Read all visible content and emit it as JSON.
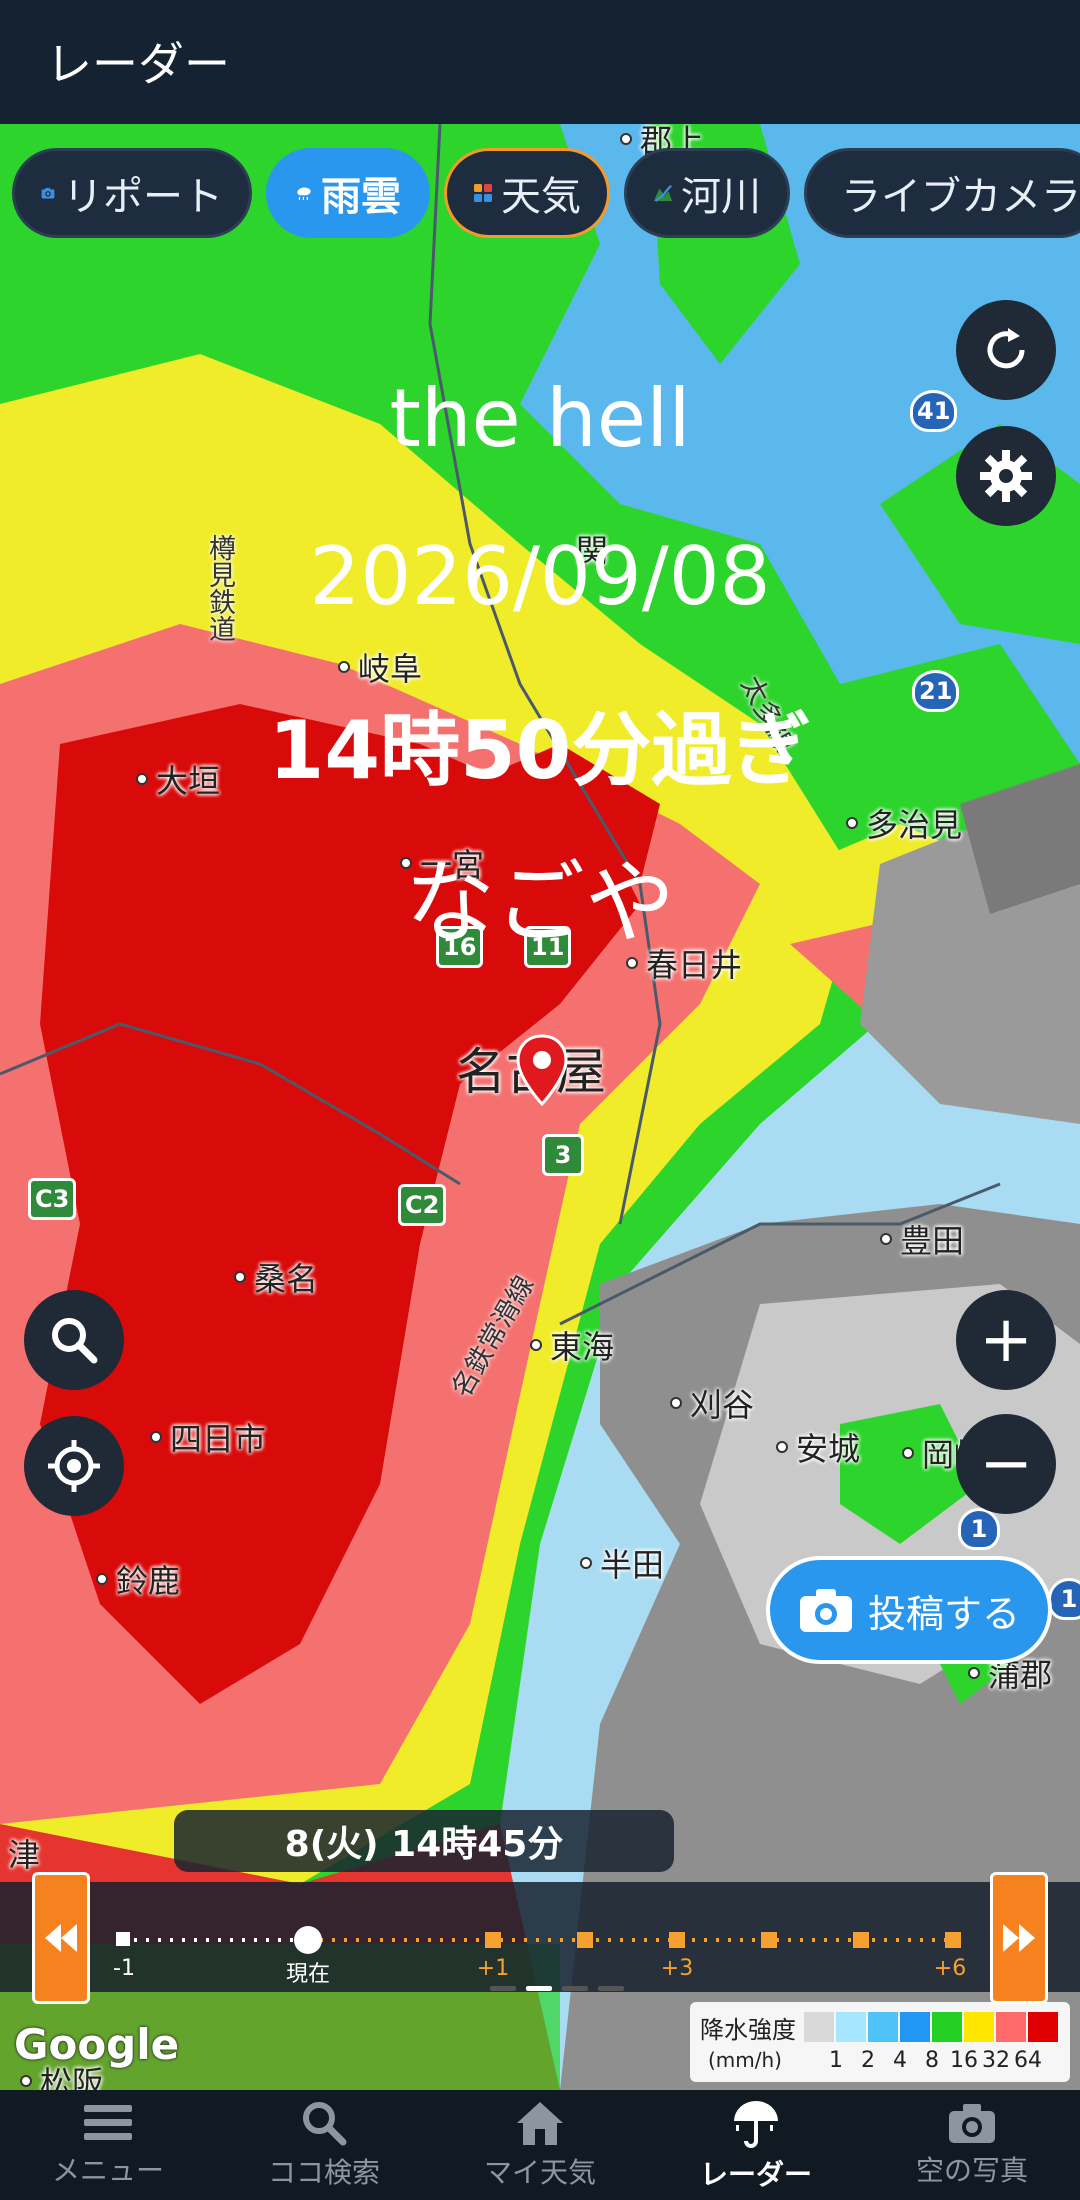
{
  "header": {
    "title": "レーダー"
  },
  "chips": [
    {
      "label": "リポート",
      "icon": "camera-icon"
    },
    {
      "label": "雨雲",
      "icon": "rain-cloud-icon",
      "active": true
    },
    {
      "label": "天気",
      "icon": "weather-grid-icon"
    },
    {
      "label": "河川",
      "icon": "river-icon"
    },
    {
      "label": "ライブカメラ",
      "icon": "video-camera-icon"
    }
  ],
  "overlay": {
    "line1": "the hell",
    "line2": "2026/09/08",
    "line3": "14時50分過ぎ",
    "line4": "なごや"
  },
  "map": {
    "cities": [
      {
        "name": "岐阜"
      },
      {
        "name": "大垣"
      },
      {
        "name": "多治見"
      },
      {
        "name": "春日井"
      },
      {
        "name": "名古屋"
      },
      {
        "name": "豊田"
      },
      {
        "name": "桑名"
      },
      {
        "name": "東海"
      },
      {
        "name": "刈谷"
      },
      {
        "name": "安城"
      },
      {
        "name": "岡崎"
      },
      {
        "name": "四日市"
      },
      {
        "name": "半田"
      },
      {
        "name": "鈴鹿"
      },
      {
        "name": "蒲郡"
      },
      {
        "name": "津"
      },
      {
        "name": "松阪"
      },
      {
        "name": "郡上"
      },
      {
        "name": "関"
      },
      {
        "name": "一宮"
      }
    ],
    "rails": [
      {
        "name": "樽見鉄道"
      },
      {
        "name": "名鉄常滑線"
      },
      {
        "name": "太多線"
      }
    ],
    "shields": [
      "41",
      "21",
      "16",
      "11",
      "3",
      "C2",
      "C3",
      "1",
      "1"
    ],
    "attribution": "Google"
  },
  "buttons": {
    "refresh_icon": "refresh-icon",
    "settings_icon": "gear-icon",
    "search_icon": "search-icon",
    "locate_icon": "locate-icon",
    "zoom_in": "+",
    "zoom_out": "−",
    "post_label": "投稿する"
  },
  "timeline": {
    "current_time": "8(火) 14時45分",
    "ticks": [
      "-1",
      "現在",
      "+1",
      "+3",
      "+6"
    ]
  },
  "legend": {
    "title": "降水強度",
    "unit": "(mm/h)",
    "values": [
      "1",
      "2",
      "4",
      "8",
      "16",
      "32",
      "64"
    ],
    "colors": [
      "#d9d9d9",
      "#a6e6ff",
      "#4fc3f7",
      "#2196f3",
      "#25d025",
      "#ffe600",
      "#ff6a6a",
      "#e00000"
    ]
  },
  "nav": [
    {
      "label": "メニュー",
      "icon": "menu-icon"
    },
    {
      "label": "ココ検索",
      "icon": "search-icon"
    },
    {
      "label": "マイ天気",
      "icon": "home-icon"
    },
    {
      "label": "レーダー",
      "icon": "umbrella-icon",
      "active": true
    },
    {
      "label": "空の写真",
      "icon": "camera-icon"
    }
  ]
}
